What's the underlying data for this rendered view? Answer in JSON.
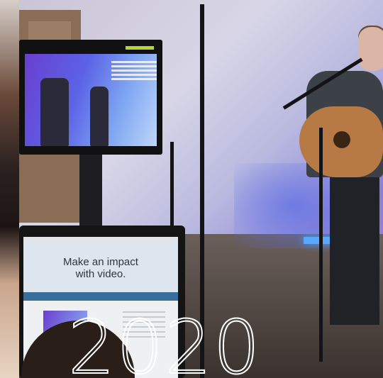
{
  "photo": {
    "description_icon": "photo-icon"
  },
  "tablet": {
    "headline_line1": "Make an impact",
    "headline_line2": "with video."
  },
  "overlay": {
    "year": "2020"
  }
}
